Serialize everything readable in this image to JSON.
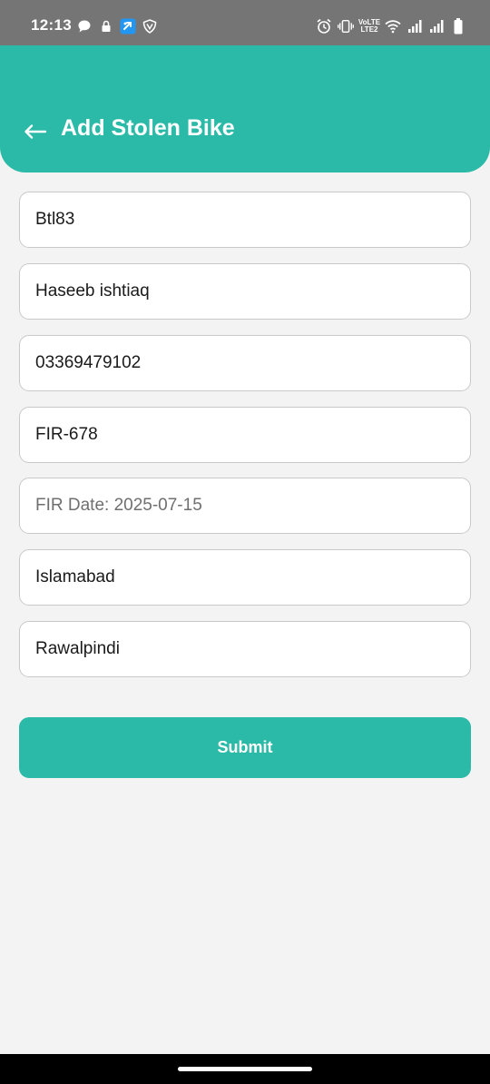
{
  "status_bar": {
    "time": "12:13",
    "left_icons": [
      "chat-bubble-icon",
      "lock-icon",
      "messaging-app-icon",
      "vpn-shield-icon"
    ],
    "right_icons": [
      "alarm-icon",
      "vibrate-icon",
      "volte-icon",
      "wifi-icon",
      "signal-icon",
      "signal-icon",
      "battery-icon"
    ],
    "volte_line1": "VoLTE",
    "volte_line2": "LTE2"
  },
  "header": {
    "back_icon": "arrow-left-icon",
    "title": "Add Stolen Bike",
    "background_color": "#2bbaa7"
  },
  "form": {
    "fields": [
      {
        "name": "bike-number-field",
        "value": "Btl83"
      },
      {
        "name": "owner-name-field",
        "value": "Haseeb ishtiaq"
      },
      {
        "name": "phone-number-field",
        "value": "03369479102"
      },
      {
        "name": "fir-number-field",
        "value": "FIR-678"
      },
      {
        "name": "fir-date-field",
        "value": "FIR Date: 2025-07-15"
      },
      {
        "name": "city-field",
        "value": "Islamabad"
      },
      {
        "name": "area-field",
        "value": "Rawalpindi"
      }
    ],
    "submit_label": "Submit"
  },
  "colors": {
    "accent": "#2bbaa7",
    "status_bar": "#757575",
    "page_background": "#f3f3f3"
  }
}
